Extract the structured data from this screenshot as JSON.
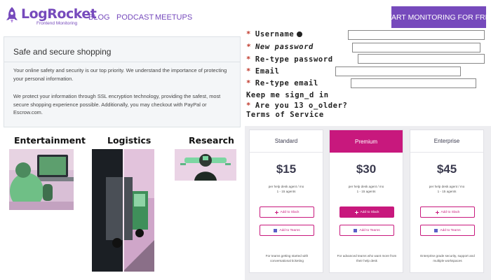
{
  "header": {
    "logo_text": "LogRocket",
    "logo_sub": "Frontend Monitoring",
    "nav": [
      "BLOG",
      "PODCAST",
      "MEETUPS"
    ],
    "cta": "START MONITORING FOR FREE",
    "brand_color": "#764abc"
  },
  "info": {
    "title": "Safe and secure shopping",
    "p1": "Your online safety and security is our top priority. We understand the importance of protecting your personal information.",
    "p2": "We protect your information through SSL encryption technology, providing the safest, most secure shopping experience possible. Additionally, you may checkout with PayPal or Escrow.com."
  },
  "form": {
    "username": "Username",
    "new_password": "New password",
    "retype_password": "Re-type password",
    "email": "Email",
    "retype_email": "Re-type email",
    "keep_signed": "Keep me sign_d in",
    "age": "Are you 13 o_older?",
    "terms": "Terms of Service",
    "required_marker": "*"
  },
  "categories": {
    "entertainment": "Entertainment",
    "logistics": "Logistics",
    "research": "Research"
  },
  "pricing": {
    "accent_color": "#c8187d",
    "plans": [
      {
        "name": "Standard",
        "price": "$15",
        "unit": "per help desk agent / mo",
        "agents": "1 - 15 agents",
        "slack": "Add to Slack",
        "teams": "Add to Teams",
        "desc": "For teams getting started with conversational ticketing"
      },
      {
        "name": "Premium",
        "price": "$30",
        "unit": "per help desk agent / mo",
        "agents": "1 - 15 agents",
        "slack": "Add to Slack",
        "teams": "Add to Teams",
        "desc": "For advanced teams who want more from their help desk"
      },
      {
        "name": "Enterprise",
        "price": "$45",
        "unit": "per help desk agent / mo",
        "agents": "1 - 15 agents",
        "slack": "Add to Slack",
        "teams": "Add to Teams",
        "desc": "Enterprise grade security, support and multiple workspaces"
      }
    ]
  }
}
